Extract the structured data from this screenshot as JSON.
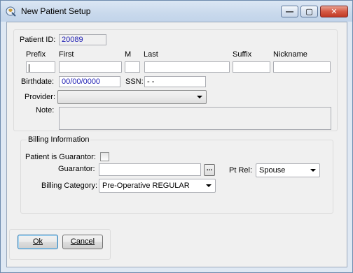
{
  "window": {
    "title": "New Patient Setup",
    "minimize_glyph": "—",
    "maximize_glyph": "▢",
    "close_glyph": "✕"
  },
  "patient": {
    "id_label": "Patient ID:",
    "id_value": "20089",
    "prefix_label": "Prefix",
    "first_label": "First",
    "middle_label": "M",
    "last_label": "Last",
    "suffix_label": "Suffix",
    "nickname_label": "Nickname",
    "prefix_value": "",
    "first_value": "",
    "middle_value": "",
    "last_value": "",
    "suffix_value": "",
    "nickname_value": "",
    "birthdate_label": "Birthdate:",
    "birthdate_value": "00/00/0000",
    "ssn_label": "SSN:",
    "ssn_value": " -  -",
    "provider_label": "Provider:",
    "provider_value": "",
    "note_label": "Note:",
    "note_value": ""
  },
  "billing": {
    "group_label": "Billing Information",
    "guarantor_check_label": "Patient is Guarantor:",
    "guarantor_checked": false,
    "guarantor_label": "Guarantor:",
    "guarantor_value": "",
    "browse_label": "...",
    "pt_rel_label": "Pt Rel:",
    "pt_rel_value": "Spouse",
    "category_label": "Billing Category:",
    "category_value": "Pre-Operative REGULAR"
  },
  "buttons": {
    "ok_label": "Ok",
    "cancel_label": "Cancel"
  }
}
